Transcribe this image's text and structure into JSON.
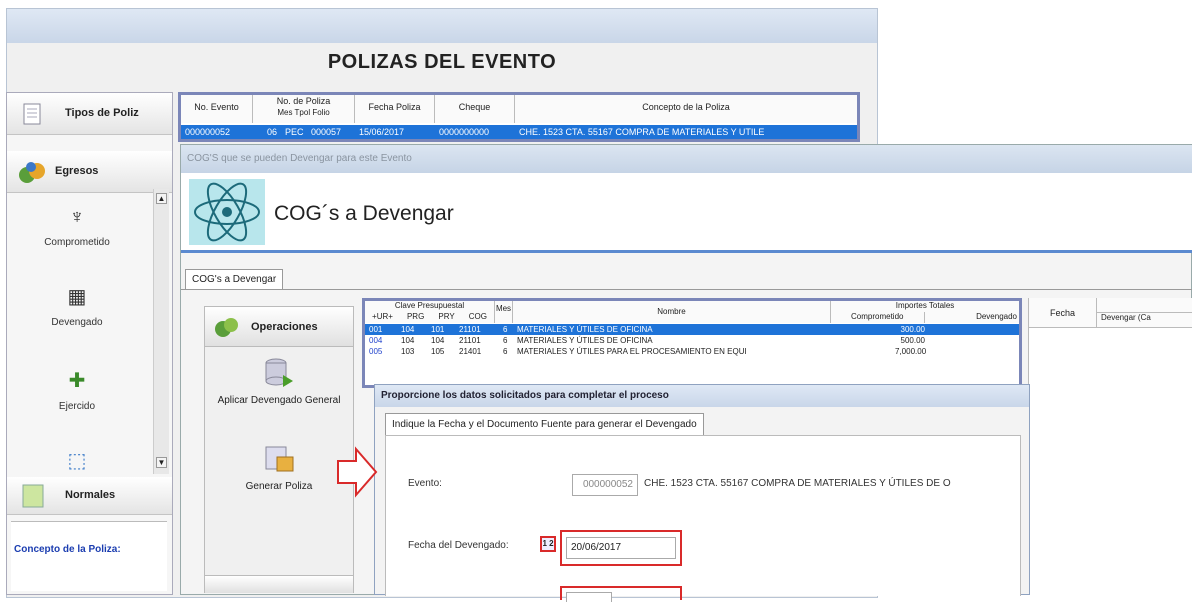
{
  "back_window": {
    "title": "POLIZAS DEL EVENTO",
    "sidebar": {
      "tipos_label": "Tipos de Poliz",
      "egresos_label": "Egresos",
      "items": [
        {
          "label": "Comprometido",
          "icon": "comprometido-icon"
        },
        {
          "label": "Devengado",
          "icon": "devengado-icon"
        },
        {
          "label": "Ejercido",
          "icon": "ejercido-icon"
        },
        {
          "label": "",
          "icon": "pagado-icon"
        }
      ],
      "normales_label": "Normales",
      "concepto_label": "Concepto de la Poliza:"
    },
    "grid": {
      "headers": {
        "no_evento": "No. Evento",
        "no_poliza": "No. de Poliza",
        "mes": "Mes",
        "tpol": "Tpol",
        "folio": "Folio",
        "fecha": "Fecha Poliza",
        "cheque": "Cheque",
        "concepto": "Concepto de la Poliza"
      },
      "row": {
        "no_evento": "000000052",
        "mes": "06",
        "tpol": "PEC",
        "folio": "000057",
        "fecha": "15/06/2017",
        "cheque": "0000000000",
        "concepto": "CHE. 1523 CTA. 55167 COMPRA DE MATERIALES Y UTILE"
      }
    }
  },
  "front_window": {
    "titlebar": "COG'S que se pueden Devengar para este Evento",
    "banner_title": "COG´s a Devengar",
    "tab_label": "COG's a Devengar",
    "operaciones": {
      "header": "Operaciones",
      "aplicar_label": "Aplicar Devengado General",
      "generar_label": "Generar Poliza"
    },
    "grid": {
      "clave_header": "Clave Presupuestal",
      "sub_headers": [
        "+UR+",
        "PRG",
        "PRY",
        "COG"
      ],
      "mes_header": "Mes",
      "nombre_header": "Nombre",
      "importes_header": "Importes Totales",
      "comprometido_header": "Comprometido",
      "devengado_header": "Devengado",
      "rows": [
        {
          "ur": "001",
          "prg": "104",
          "pry": "101",
          "cog": "21101",
          "mes": "6",
          "nombre": "MATERIALES Y ÚTILES DE OFICINA",
          "comprometido": "300.00",
          "selected": true
        },
        {
          "ur": "004",
          "prg": "104",
          "pry": "104",
          "cog": "21101",
          "mes": "6",
          "nombre": "MATERIALES Y ÚTILES DE OFICINA",
          "comprometido": "500.00",
          "selected": false
        },
        {
          "ur": "005",
          "prg": "103",
          "pry": "105",
          "cog": "21401",
          "mes": "6",
          "nombre": "MATERIALES Y ÚTILES PARA EL PROCESAMIENTO EN EQUI",
          "comprometido": "7,000.00",
          "selected": false
        }
      ]
    },
    "right_panel": {
      "fecha_header": "Fecha",
      "devengar_header": "Devengar (Ca"
    }
  },
  "dialog": {
    "title": "Proporcione los datos solicitados para completar el proceso",
    "tab_label": "Indique la Fecha y el Documento Fuente para generar el Devengado",
    "evento_label": "Evento:",
    "evento_value": "000000052",
    "evento_desc": "CHE. 1523 CTA. 55167 COMPRA DE MATERIALES Y ÚTILES DE O",
    "fecha_label": "Fecha del Devengado:",
    "fecha_value": "20/06/2017",
    "calendar_glyph": "1 2"
  },
  "colors": {
    "selection_blue": "#1e73d8",
    "grid_border": "#7b86b8",
    "highlight_red": "#d92a2a",
    "concept_blue": "#1b3db0"
  }
}
